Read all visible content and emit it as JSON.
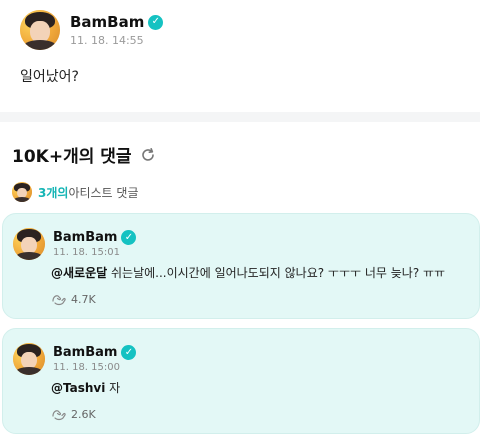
{
  "post": {
    "author": "BamBam",
    "timestamp": "11. 18. 14:55",
    "body": "일어났어?"
  },
  "comments_section": {
    "title": "10K+개의 댓글",
    "artist_comment_count": "3개의",
    "artist_comment_suffix": " 아티스트 댓글"
  },
  "comments": [
    {
      "author": "BamBam",
      "timestamp": "11. 18. 15:01",
      "mention": "@새로운달",
      "text": " 쉬는날에...이시간에 일어나도되지 않나요? ㅜㅜㅜ 너무 늦나? ㅠㅠ",
      "likes": "4.7K"
    },
    {
      "author": "BamBam",
      "timestamp": "11. 18. 15:00",
      "mention": "@Tashvi",
      "text": " 자",
      "likes": "2.6K"
    }
  ],
  "icons": {
    "verified": "verified-badge-icon",
    "refresh": "refresh-icon",
    "like": "hands-like-icon"
  },
  "colors": {
    "accent": "#15c2c2",
    "card_bg": "#e3f8f6"
  }
}
